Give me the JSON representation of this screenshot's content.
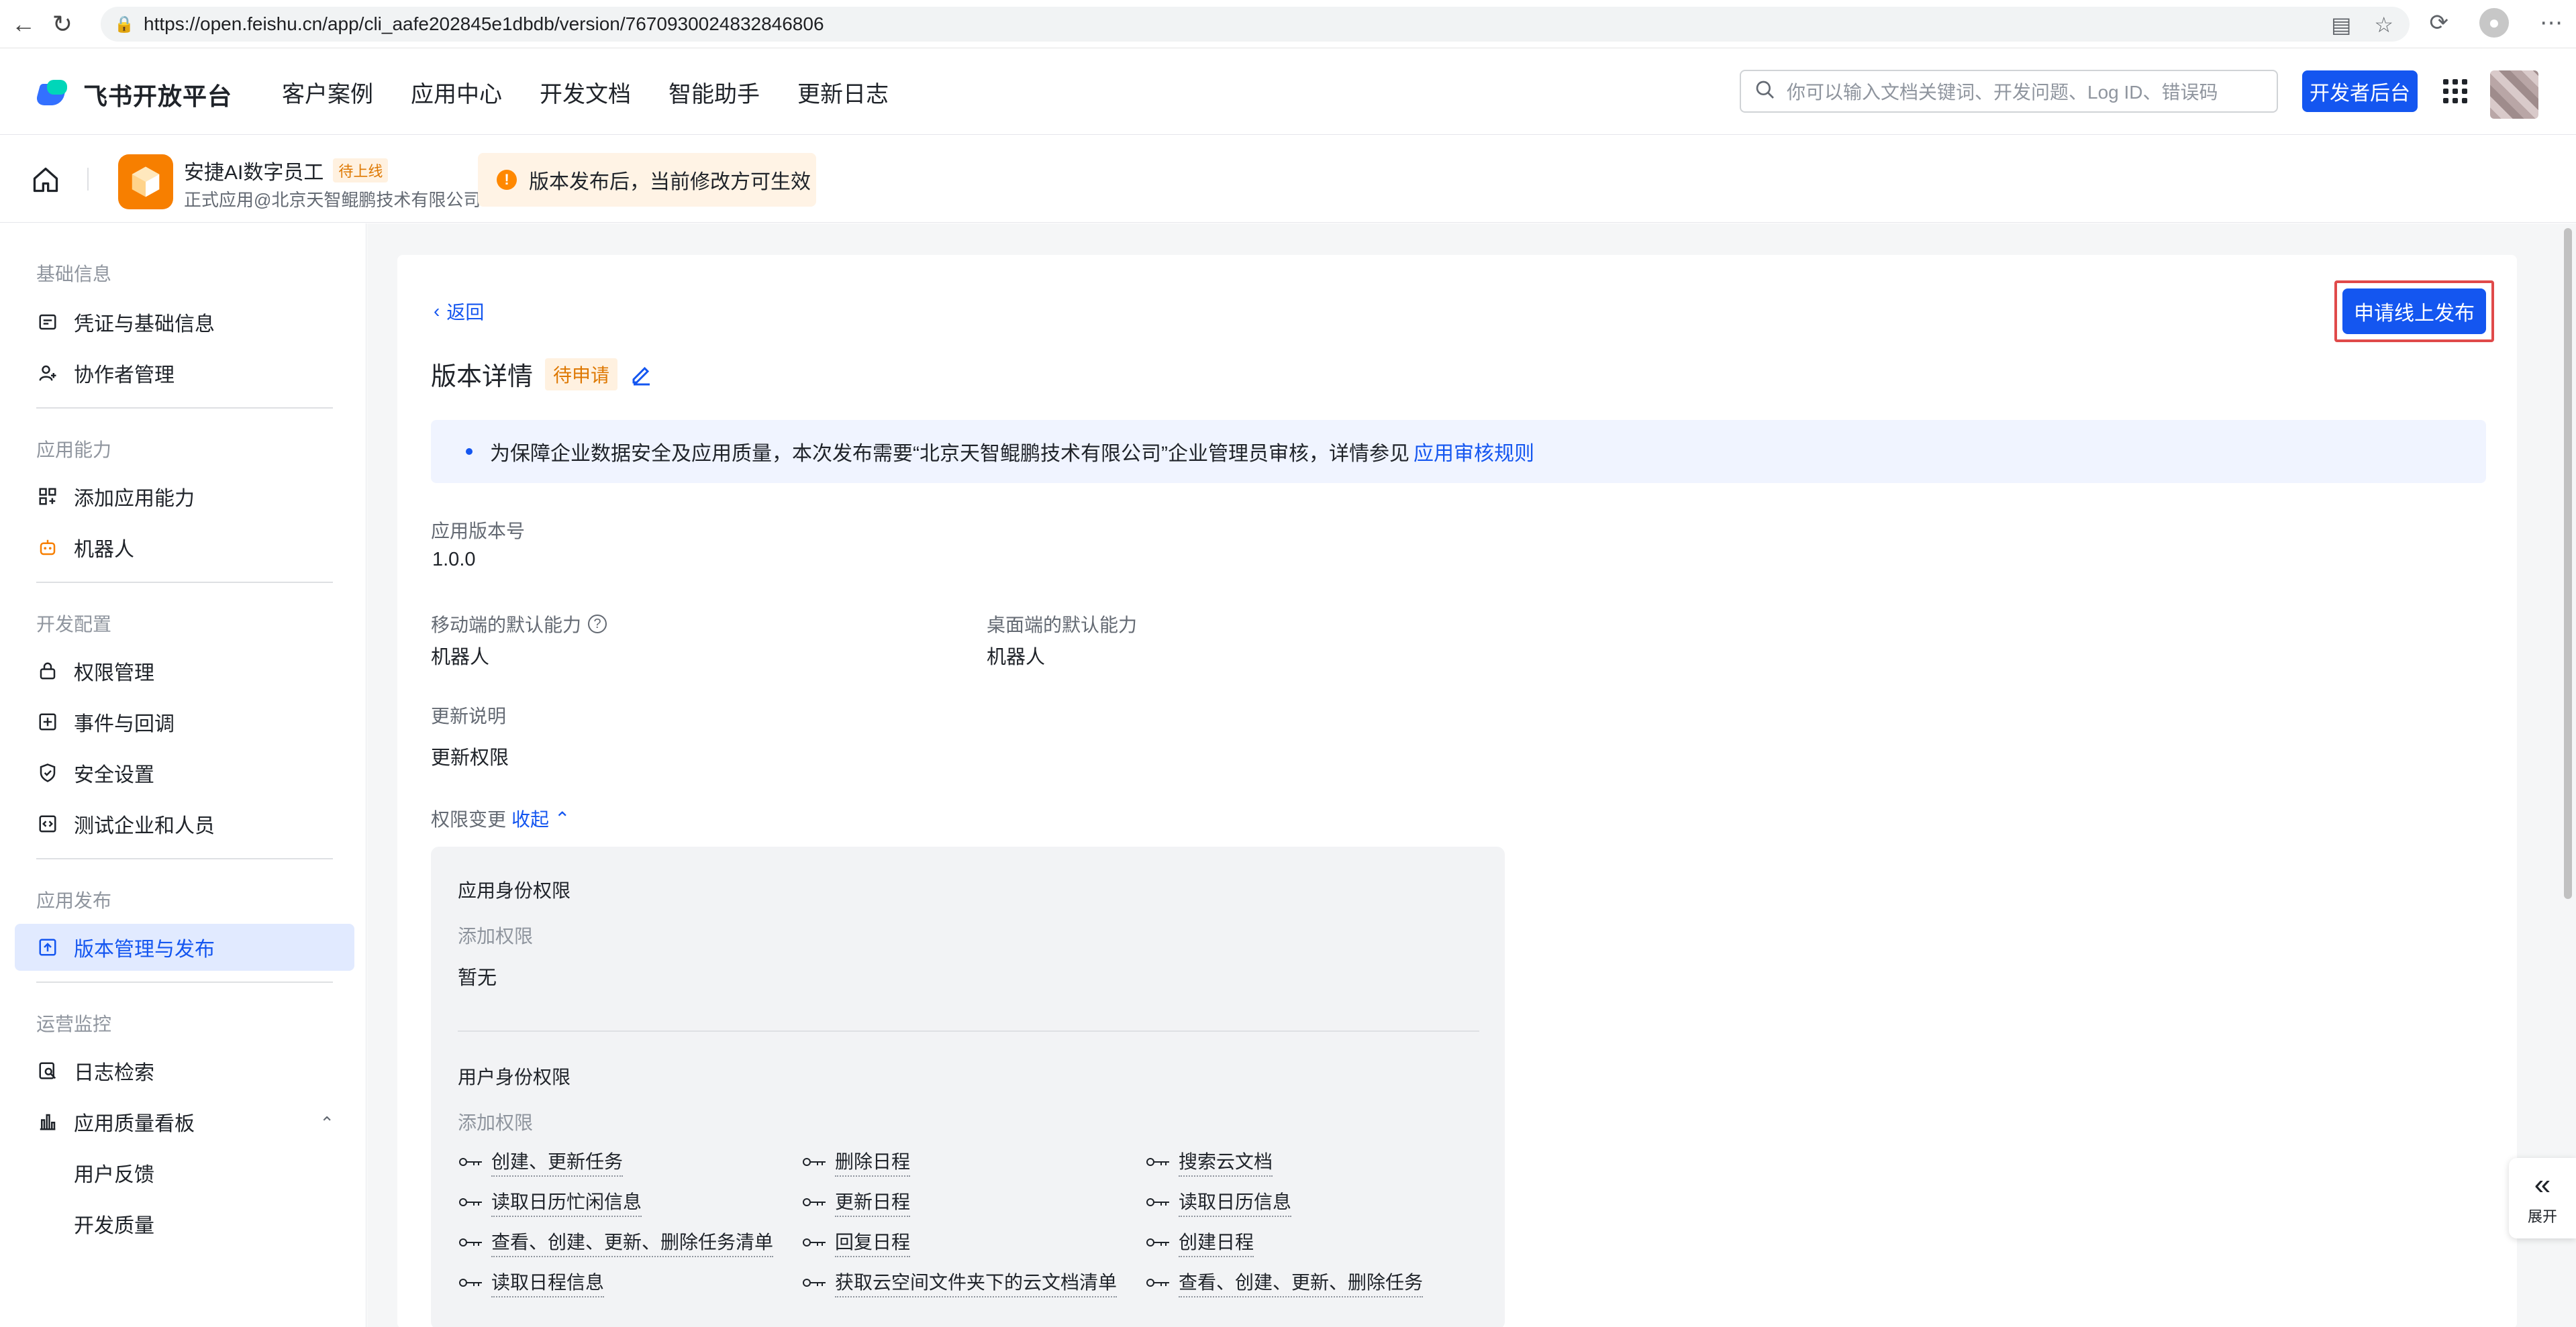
{
  "browser": {
    "url": "https://open.feishu.cn/app/cli_aafe202845e1dbdb/version/7670930024832846806",
    "icons": [
      "back-icon",
      "reload-icon",
      "lock-icon",
      "reader-icon",
      "star-icon",
      "history-icon",
      "profile-icon",
      "more-icon"
    ]
  },
  "topnav": {
    "logo_text": "飞书开放平台",
    "menu": [
      "客户案例",
      "应用中心",
      "开发文档",
      "智能助手",
      "更新日志"
    ],
    "search_placeholder": "你可以输入文档关键词、开发问题、Log ID、错误码",
    "dev_button": "开发者后台"
  },
  "app": {
    "name": "安捷AI数字员工",
    "badge": "待上线",
    "subtitle": "正式应用@北京天智鲲鹏技术有限公司",
    "notice": "版本发布后，当前修改方可生效"
  },
  "sidebar": {
    "sections": [
      {
        "title": "基础信息",
        "items": [
          {
            "label": "凭证与基础信息",
            "icon": "credential-icon"
          },
          {
            "label": "协作者管理",
            "icon": "user-add-icon"
          }
        ]
      },
      {
        "title": "应用能力",
        "items": [
          {
            "label": "添加应用能力",
            "icon": "grid-add-icon"
          },
          {
            "label": "机器人",
            "icon": "robot-icon"
          }
        ]
      },
      {
        "title": "开发配置",
        "items": [
          {
            "label": "权限管理",
            "icon": "lock-icon"
          },
          {
            "label": "事件与回调",
            "icon": "event-icon"
          },
          {
            "label": "安全设置",
            "icon": "shield-icon"
          },
          {
            "label": "测试企业和人员",
            "icon": "code-icon"
          }
        ]
      },
      {
        "title": "应用发布",
        "items": [
          {
            "label": "版本管理与发布",
            "icon": "upload-icon",
            "active": true
          }
        ]
      },
      {
        "title": "运营监控",
        "items": [
          {
            "label": "日志检索",
            "icon": "log-search-icon"
          },
          {
            "label": "应用质量看板",
            "icon": "bar-chart-icon",
            "expanded": true
          },
          {
            "label": "用户反馈"
          },
          {
            "label": "开发质量"
          }
        ]
      }
    ]
  },
  "detail": {
    "back": "返回",
    "title": "版本详情",
    "status": "待申请",
    "publish_button": "申请线上发布",
    "info_text": "为保障企业数据安全及应用质量，本次发布需要“北京天智鲲鹏技术有限公司”企业管理员审核，详情参见",
    "info_link": "应用审核规则",
    "version_label": "应用版本号",
    "version_value": "1.0.0",
    "mobile_label": "移动端的默认能力",
    "mobile_value": "机器人",
    "desktop_label": "桌面端的默认能力",
    "desktop_value": "机器人",
    "notes_label": "更新说明",
    "notes_value": "更新权限",
    "perm_label": "权限变更",
    "perm_toggle": "收起"
  },
  "permissions": {
    "app_title": "应用身份权限",
    "app_sub": "添加权限",
    "app_value": "暂无",
    "user_title": "用户身份权限",
    "user_sub": "添加权限",
    "user_items": [
      "创建、更新任务",
      "删除日程",
      "搜索云文档",
      "读取日历忙闲信息",
      "更新日程",
      "读取日历信息",
      "查看、创建、更新、删除任务清单",
      "回复日程",
      "创建日程",
      "读取日程信息",
      "获取云空间文件夹下的云文档清单",
      "查看、创建、更新、删除任务"
    ]
  },
  "expand": {
    "label": "展开"
  }
}
